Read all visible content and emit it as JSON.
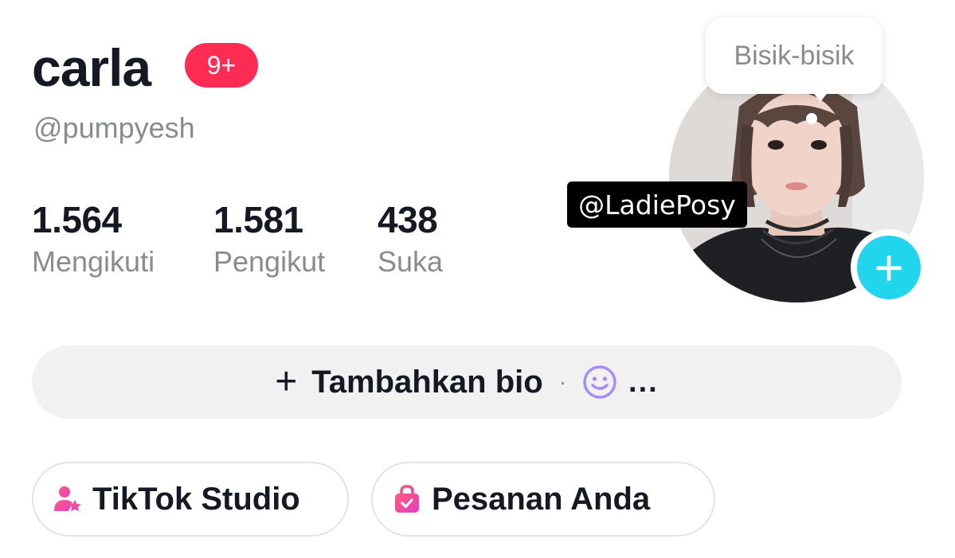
{
  "profile": {
    "name": "carla",
    "notification_badge": "9+",
    "handle": "@pumpyesh",
    "tooltip": "Bisik-bisik",
    "watermark": "@LadiePosy"
  },
  "stats": [
    {
      "value": "1.564",
      "label": "Mengikuti"
    },
    {
      "value": "1.581",
      "label": "Pengikut"
    },
    {
      "value": "438",
      "label": "Suka"
    }
  ],
  "bio": {
    "add_label": "Tambahkan bio",
    "separator": "·",
    "more": "..."
  },
  "buttons": {
    "studio": "TikTok Studio",
    "orders": "Pesanan Anda"
  },
  "icons": {
    "add_avatar": "plus-icon",
    "bio_add": "plus-icon",
    "emoji": "smile-icon",
    "studio": "creator-star-icon",
    "orders": "shopping-bag-icon"
  },
  "colors": {
    "badge": "#fe2c55",
    "add_avatar": "#20d5ec",
    "muted_text": "#8a8b91",
    "primary_text": "#161823",
    "emoji": "#a78bfa",
    "icon_gradient_start": "#ff5a7a",
    "icon_gradient_end": "#e63cc6"
  }
}
